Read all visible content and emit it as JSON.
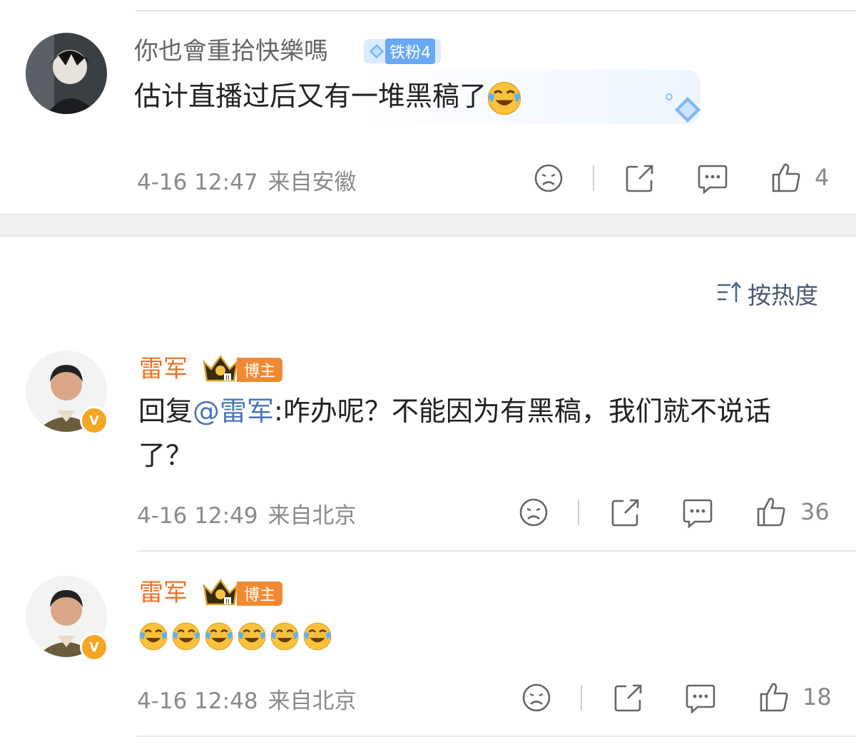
{
  "sort": {
    "icon": "sort-icon",
    "label": "按热度"
  },
  "comments": [
    {
      "username": "你也會重拾快樂嗎",
      "badge": "铁粉4",
      "text": "估计直播过后又有一堆黑稿了",
      "time": "4-16 12:47",
      "location": "来自安徽",
      "likes": "4"
    },
    {
      "username": "雷军",
      "badge": "博主",
      "reply_prefix": "回复",
      "mention": "@雷军",
      "text": ":咋办呢？不能因为有黑稿，我们就不说话了？",
      "time": "4-16 12:49",
      "location": "来自北京",
      "likes": "36"
    },
    {
      "username": "雷军",
      "badge": "博主",
      "emoji_count": 6,
      "time": "4-16 12:48",
      "location": "来自北京",
      "likes": "18"
    }
  ],
  "colors": {
    "username_gray": "#666666",
    "username_orange": "#e8742a",
    "mention": "#4a78b5",
    "meta": "#8a8a8a",
    "fan_badge": "#69a8f5",
    "host_badge": "#f08a32"
  },
  "icons": [
    "dislike-icon",
    "share-icon",
    "comment-icon",
    "like-icon",
    "laugh-cry-emoji"
  ]
}
